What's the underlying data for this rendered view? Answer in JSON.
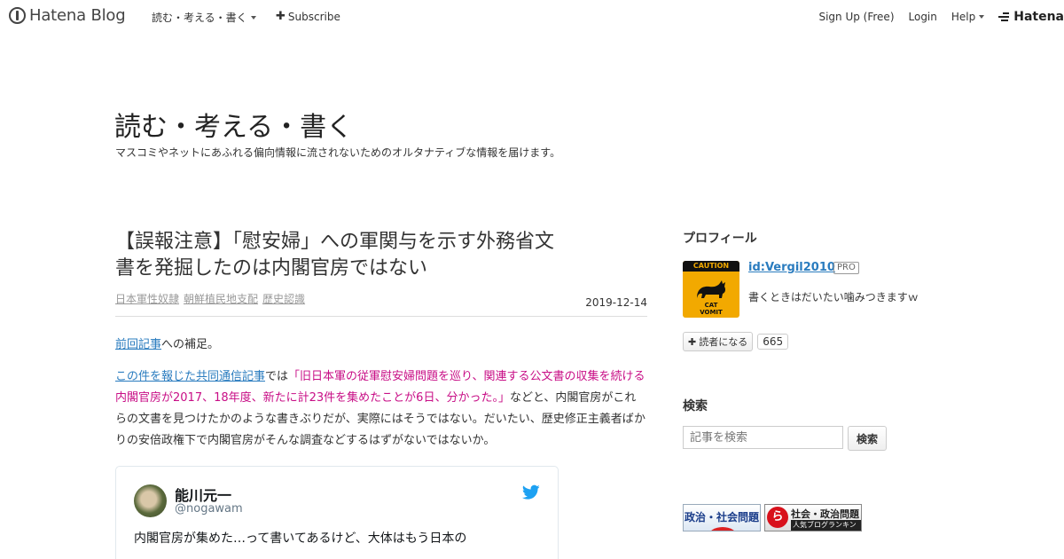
{
  "globalbar": {
    "logo_text": "Hatena Blog",
    "blog_menu": "読む・考える・書く",
    "subscribe": "Subscribe",
    "signup": "Sign Up (Free)",
    "login": "Login",
    "help": "Help",
    "hatena": "Hatena"
  },
  "blog": {
    "title": "読む・考える・書く",
    "description": "マスコミやネットにあふれる偏向情報に流されないためのオルタナティブな情報を届けます。"
  },
  "entry": {
    "title": "【誤報注意】「慰安婦」への軍関与を示す外務省文書を発掘したのは内閣官房ではない",
    "categories": [
      "日本軍性奴隷",
      "朝鮮植民地支配",
      "歴史認識"
    ],
    "date": "2019-12-14",
    "p1_link": "前回記事",
    "p1_text": "への補足。",
    "p2_link": "この件を報じた共同通信記事",
    "p2_mid": "では",
    "p2_quote": "「旧日本軍の従軍慰安婦問題を巡り、関連する公文書の収集を続ける内閣官房が2017、18年度、新たに計23件を集めたことが6日、分かった。」",
    "p2_after": "などと、内閣官房がこれらの文書を見つけたかのような書きぶりだが、実際にはそうではない。だいたい、歴史修正主義者ばかりの安倍政権下で内閣官房がそんな調査などするはずがないではないか。",
    "tweet": {
      "name": "能川元一",
      "handle": "@nogawam",
      "text": "内閣官房が集めた…って書いてあるけど、大体はもう日本の"
    }
  },
  "sidebar": {
    "profile_title": "プロフィール",
    "caution_top": "CAUTION",
    "caution_bottom_1": "CAT",
    "caution_bottom_2": "VOMIT",
    "profile_id": "id:Vergil2010",
    "pro_badge": "PRO",
    "profile_desc": "書くときはだいたい噛みつきますｗ",
    "subscribe_label": "読者になる",
    "subscriber_count": "665",
    "search_title": "検索",
    "search_placeholder": "記事を検索",
    "search_button": "検索",
    "banner1": "政治・社会問題",
    "banner2_icon": "ら",
    "banner2_line1": "社会・政治問題",
    "banner2_line2": "人気ブログランキング"
  },
  "colors": {
    "link": "#2a7cbf",
    "quote": "#c80e86",
    "twitter": "#1da1f2",
    "caution": "#f2a900"
  }
}
